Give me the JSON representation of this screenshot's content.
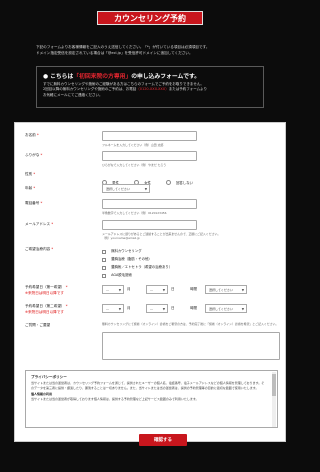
{
  "header": {
    "title": "カウンセリング予約"
  },
  "intro": {
    "line1": "下記のフォームよりお客様情報をご記入のうえ送信してください。「*」が付いている項目は必須項目です。",
    "line2": "ドメイン指定受信を設定されている場合は「@ecl.jp」を受信許可ドメインに追加してください。"
  },
  "notice": {
    "title_prefix": "● こちらは",
    "title_highlight": "「初回来院の方専用」",
    "title_suffix": "の申し込みフォームです。",
    "body_line1": "すでに無料カウンセリングや施術のご経験がある方はこちらのフォームでご予約をお取りできません。",
    "body_line2_prefix": "2回目以降の無料カウンセリングや施術のご予約は、お電話",
    "body_link": "（0120-XXX-XXX）",
    "body_line2_suffix": "または予約フォームより",
    "body_line3": "お気軽にメールにてご連絡ください。"
  },
  "form": {
    "name": {
      "label": "お名前",
      "hint": "フルネームを入力してください（例）山田 太郎"
    },
    "furigana": {
      "label": "ふりがな",
      "hint": "ひらがなで入力してください（例）やまだ たろう"
    },
    "gender": {
      "label": "性別",
      "options": [
        "男性",
        "女性",
        "回答しない"
      ]
    },
    "age": {
      "label": "年齢",
      "value": "選択してください"
    },
    "phone": {
      "label": "電話番号",
      "hint": "半角数字で入力してください（例）0120123456"
    },
    "email": {
      "label": "メールアドレス",
      "hint1": "メールアドレスに誤りがあるとご連絡することが出来ませんので、正確にご記入ください。",
      "hint2": "（例）yourname@email.jp"
    },
    "menu": {
      "label": "ご希望治療内容",
      "options": [
        "無料カウンセリング",
        "豊胸治療（脂肪・その他）",
        "豊胸術／エトセトラ（希望の治療あり）",
        "AGA脱毛施術"
      ]
    },
    "date1": {
      "label": "予約希望日（第一希望）",
      "note": "※来院日は明日以降です",
      "month": "月",
      "day": "日",
      "time_label": "時間",
      "time_value": "選択してください",
      "empty": "―"
    },
    "date2": {
      "label": "予約希望日（第二希望）",
      "note": "※来院日は明日以降です",
      "month": "月",
      "day": "日",
      "time_label": "時間",
      "time_value": "選択してください",
      "empty": "―"
    },
    "question": {
      "label": "ご質問・ご要望",
      "hint": "無料カウンセリングにて施術（オンライン）診療をご希望の方は、予約完了後に「施術（オンライン）診療を希望」とご記入ください。"
    },
    "required": "*"
  },
  "privacy": {
    "title": "プライバシーポリシー",
    "body": "当サイトまたは当の運営者は、カウンセリング予約フォームを通じて、提供されたユーザーの個人名、電話番号、電子メールアドレスなどの個人情報を管理しております。そのデータを第三者に提供・譲渡したり、漏洩することは一切ありません。また、当サイトまたは当の運営者は、提供の予約管理等の目的に適切な範囲で使用いたします。",
    "sub_title": "個人情報の利用",
    "sub_body": "当サイトまたは当の運営者が取得しております個人情報は、提供する予約管理など上記サービス範囲のみで利用いたします。"
  },
  "submit": {
    "label": "確認する"
  }
}
